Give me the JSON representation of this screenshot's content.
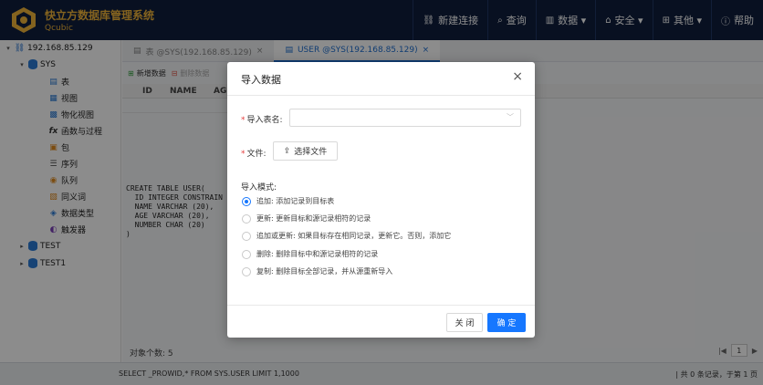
{
  "app": {
    "title": "快立方数据库管理系统",
    "subtitle": "Qcubic"
  },
  "nav": [
    {
      "icon": "link-icon",
      "glyph": "🔗",
      "label": "新建连接"
    },
    {
      "icon": "search-icon",
      "glyph": "⌕",
      "label": "查询"
    },
    {
      "icon": "chart-icon",
      "glyph": "▥",
      "label": "数据 ▾"
    },
    {
      "icon": "lock-icon",
      "glyph": "🔒",
      "label": "安全 ▾"
    },
    {
      "icon": "grid-icon",
      "glyph": "⊞",
      "label": "其他 ▾"
    },
    {
      "icon": "help-icon",
      "glyph": "?",
      "label": "帮助"
    }
  ],
  "tree": {
    "connection": "192.168.85.129",
    "schemas": [
      "SYS",
      "TEST",
      "TEST1"
    ],
    "sys_items": [
      "表",
      "视图",
      "物化视图",
      "函数与过程",
      "包",
      "序列",
      "队列",
      "同义词",
      "数据类型",
      "触发器"
    ]
  },
  "tabs": [
    {
      "label": "表 @SYS(192.168.85.129)",
      "close": "×"
    },
    {
      "label": "USER @SYS(192.168.85.129)",
      "close": "×"
    }
  ],
  "toolbar": {
    "add": "新增数据",
    "delete": "删除数据"
  },
  "grid": {
    "columns": [
      "ID",
      "NAME",
      "AG"
    ]
  },
  "ddl": "CREATE TABLE USER(\n  ID INTEGER CONSTRAIN\n  NAME VARCHAR (20),\n  AGE VARCHAR (20),\n  NUMBER CHAR (20)\n)",
  "object_count": "对象个数: 5",
  "pager": {
    "first": "|◀",
    "prev": "◀",
    "page": "1",
    "next": "▶",
    "last": "▶|"
  },
  "status": {
    "sql": "SELECT _PROWID,* FROM SYS.USER LIMIT 1,1000",
    "records": "| 共 0 条记录，于第 1 页"
  },
  "modal": {
    "title": "导入数据",
    "close": "×",
    "table_label": "导入表名:",
    "file_label": "文件:",
    "upload_label": "选择文件",
    "mode_label": "导入模式:",
    "modes": [
      {
        "label": "追加: 添加记录到目标表",
        "checked": true
      },
      {
        "label": "更新: 更新目标和源记录相符的记录",
        "checked": false
      },
      {
        "label": "追加或更新: 如果目标存在相同记录，更新它。否则，添加它",
        "checked": false
      },
      {
        "label": "删除: 删除目标中和源记录相符的记录",
        "checked": false
      },
      {
        "label": "复制: 删除目标全部记录，并从源重新导入",
        "checked": false
      }
    ],
    "cancel": "关 闭",
    "ok": "确 定"
  },
  "colors": {
    "header_bg": "#0f1e3d",
    "brand": "#f0b43a",
    "primary": "#1677ff"
  }
}
